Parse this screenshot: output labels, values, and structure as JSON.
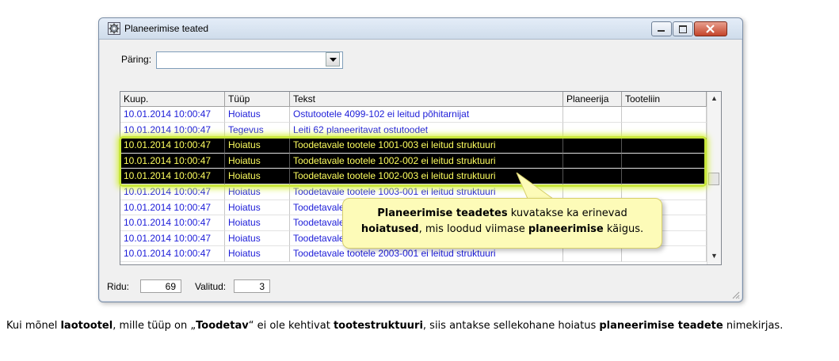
{
  "window": {
    "title": "Planeerimise teated",
    "title_icon": "gear-icon"
  },
  "query": {
    "label": "Päring:",
    "value": ""
  },
  "grid": {
    "columns": [
      "Kuup.",
      "Tüüp",
      "Tekst",
      "Planeerija",
      "Tooteliin"
    ],
    "rows": [
      {
        "date": "10.01.2014 10:00:47",
        "type": "Hoiatus",
        "text": "Ostutootele 4099-102 ei leitud põhitarnijat",
        "planner": "",
        "line": "",
        "selected": false
      },
      {
        "date": "10.01.2014 10:00:47",
        "type": "Tegevus",
        "text": "Leiti 62 planeeritavat ostutoodet",
        "planner": "",
        "line": "",
        "selected": false
      },
      {
        "date": "10.01.2014 10:00:47",
        "type": "Hoiatus",
        "text": "Toodetavale tootele 1001-003 ei leitud struktuuri",
        "planner": "",
        "line": "",
        "selected": true
      },
      {
        "date": "10.01.2014 10:00:47",
        "type": "Hoiatus",
        "text": "Toodetavale tootele 1002-002 ei leitud struktuuri",
        "planner": "",
        "line": "",
        "selected": true
      },
      {
        "date": "10.01.2014 10:00:47",
        "type": "Hoiatus",
        "text": "Toodetavale tootele 1002-003 ei leitud struktuuri",
        "planner": "",
        "line": "",
        "selected": true
      },
      {
        "date": "10.01.2014 10:00:47",
        "type": "Hoiatus",
        "text": "Toodetavale tootele 1003-001 ei leitud struktuuri",
        "planner": "",
        "line": "",
        "selected": false
      },
      {
        "date": "10.01.2014 10:00:47",
        "type": "Hoiatus",
        "text": "Toodetavale",
        "planner": "",
        "line": "",
        "selected": false
      },
      {
        "date": "10.01.2014 10:00:47",
        "type": "Hoiatus",
        "text": "Toodetavale",
        "planner": "",
        "line": "",
        "selected": false
      },
      {
        "date": "10.01.2014 10:00:47",
        "type": "Hoiatus",
        "text": "Toodetavale",
        "planner": "",
        "line": "",
        "selected": false
      },
      {
        "date": "10.01.2014 10:00:47",
        "type": "Hoiatus",
        "text": "Toodetavale tootele 2003-001 ei leitud struktuuri",
        "planner": "",
        "line": "",
        "selected": false
      }
    ]
  },
  "status": {
    "rows_label": "Ridu:",
    "rows_value": "69",
    "selected_label": "Valitud:",
    "selected_value": "3"
  },
  "callout": {
    "part1": "Planeerimise teadetes",
    "part2": " kuvatakse ka erinevad",
    "part3": "hoiatused",
    "part4": ", mis loodud viimase ",
    "part5": "planeerimise",
    "part6": " käigus."
  },
  "caption": {
    "t1": "Kui mõnel ",
    "b1": "laotootel",
    "t2": ", mille tüüp on „",
    "b2": "Toodetav",
    "t3": "“ ei ole kehtivat ",
    "b3": "tootestruktuuri",
    "t4": ", siis antakse sellekohane hoiatus ",
    "b4": "planeerimise teadete",
    "t5": " nimekirjas."
  },
  "colors": {
    "row_text": "#1c1cd8",
    "selected_bg": "#000000",
    "selected_text": "#ffff60",
    "highlight": "#c8e63a",
    "callout_bg": "#fdfbb8"
  }
}
